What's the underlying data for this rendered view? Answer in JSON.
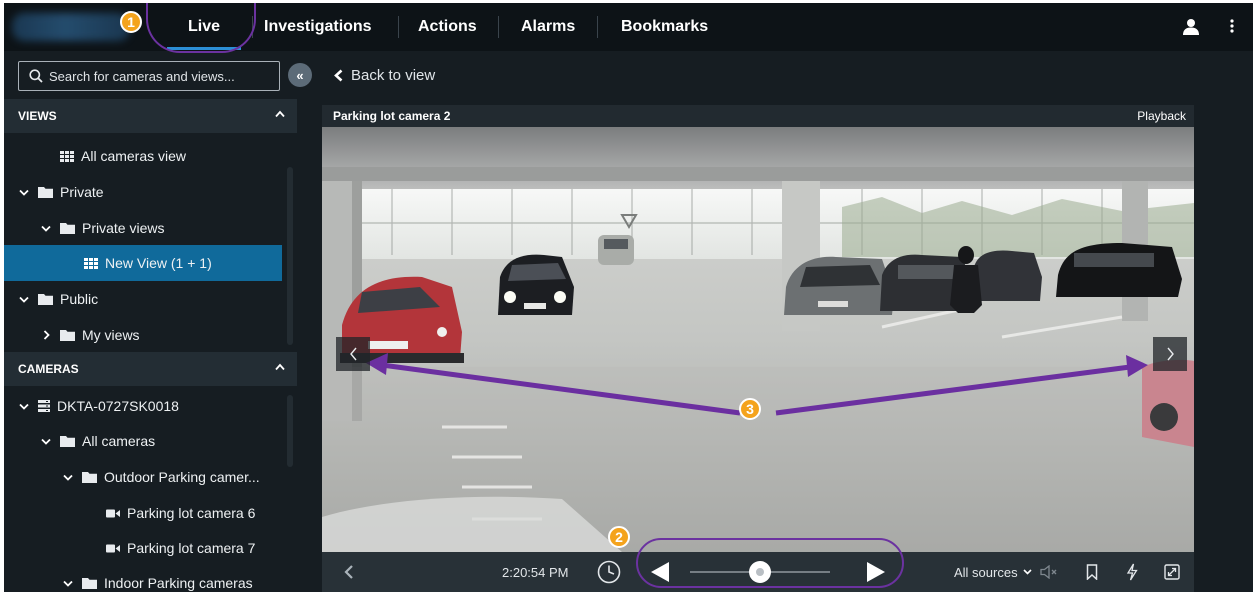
{
  "nav": {
    "tabs": [
      "Live",
      "Investigations",
      "Actions",
      "Alarms",
      "Bookmarks"
    ],
    "accent": "#2c8fd6"
  },
  "callouts": {
    "one": "1",
    "two": "2",
    "three": "3"
  },
  "sidebar": {
    "search_placeholder": "Search for cameras and views...",
    "collapse_label": "«",
    "views_header": "VIEWS",
    "cameras_header": "CAMERAS",
    "views": [
      {
        "label": "All cameras view",
        "icon": "grid-view-icon"
      },
      {
        "label": "Private",
        "icon": "folder-icon",
        "expanded": true
      },
      {
        "label": "Private views",
        "icon": "folder-icon",
        "expanded": true
      },
      {
        "label": "New View (1 + 1)",
        "icon": "grid-view-icon",
        "selected": true
      },
      {
        "label": "Public",
        "icon": "folder-icon",
        "expanded": true
      },
      {
        "label": "My views",
        "icon": "folder-icon",
        "expanded": false
      }
    ],
    "cameras": [
      {
        "label": "DKTA-0727SK0018",
        "icon": "server-icon",
        "expanded": true
      },
      {
        "label": "All cameras",
        "icon": "folder-icon",
        "expanded": true
      },
      {
        "label": "Outdoor Parking camer...",
        "icon": "folder-icon",
        "expanded": true
      },
      {
        "label": "Parking lot camera 6",
        "icon": "camera-icon"
      },
      {
        "label": "Parking lot camera 7",
        "icon": "camera-icon"
      },
      {
        "label": "Indoor Parking cameras",
        "icon": "folder-icon",
        "expanded": true
      }
    ],
    "selected_color": "#106a9b"
  },
  "main": {
    "back_label": "Back to view",
    "camera_title": "Parking lot camera 2",
    "mode_label": "Playback",
    "time": "2:20:54 PM",
    "sources_label": "All sources",
    "timeline_position": 0.5
  }
}
